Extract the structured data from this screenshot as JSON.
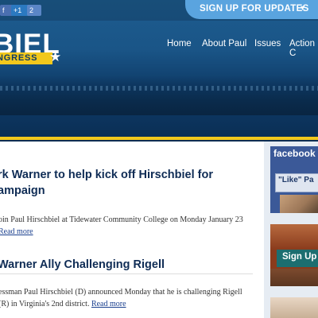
{
  "header": {
    "social": {
      "facebook": "f",
      "google": "+1",
      "count": "2"
    },
    "signup_label": "SIGN UP FOR UPDATES",
    "signup_caret": "▾",
    "logo": {
      "name": "BIEL",
      "subtitle": "NGRESS",
      "star": "★"
    },
    "nav": {
      "home": "Home",
      "about": "About Paul",
      "issues": "Issues",
      "action": "Action C"
    }
  },
  "posts": [
    {
      "title": "rk Warner to help kick off Hirschbiel for ampaign",
      "excerpt": "oin Paul Hirschbiel at Tidewater Community College on Monday January 23",
      "read_more": "Read more"
    },
    {
      "title": "Warner Ally Challenging Rigell",
      "excerpt": "essman Paul Hirschbiel (D) announced Monday that he is challenging Rigell (R) in Virginia's 2nd district.",
      "read_more": "Read more"
    }
  ],
  "sidebar": {
    "facebook_title": "facebook",
    "facebook_like": "\"Like\" Pa",
    "signup_box_label": "Sign Up"
  },
  "colors": {
    "primary_blue": "#1a5587",
    "accent_gold": "#f2c81c",
    "signup_blue": "#5aa4df",
    "link": "#1a3f8e",
    "headline": "#0f2c55"
  }
}
